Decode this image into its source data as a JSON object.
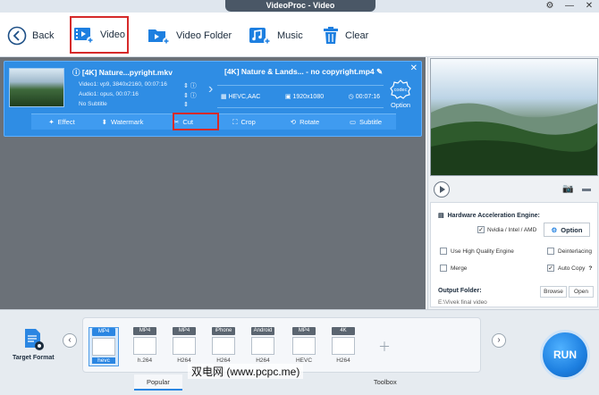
{
  "window": {
    "title": "VideoProc - Video"
  },
  "toolbar": {
    "back_label": "Back",
    "video_label": "Video",
    "video_folder_label": "Video Folder",
    "music_label": "Music",
    "clear_label": "Clear"
  },
  "clip": {
    "source_title": "[4K] Nature...pyright.mkv",
    "video_track": "Video1: vp9, 3840x2160, 00:07:16",
    "audio_track": "Audio1: opus, 00:07:16",
    "subtitle": "No Subtitle",
    "output_title": "[4K] Nature & Lands... - no copyright.mp4",
    "output_codec": "HEVC,AAC",
    "output_resolution": "1920x1080",
    "output_duration": "00:07:16",
    "codec_label": "Option",
    "codec_badge": "codec"
  },
  "edit_bar": {
    "effect": "Effect",
    "watermark": "Watermark",
    "cut": "Cut",
    "crop": "Crop",
    "rotate": "Rotate",
    "subtitle": "Subtitle"
  },
  "settings": {
    "hw_title": "Hardware Acceleration Engine:",
    "nvidia_label": "Nvidia / Intel / AMD",
    "option_label": "Option",
    "high_quality": "Use High Quality Engine",
    "deinterlacing": "Deinterlacing",
    "merge": "Merge",
    "auto_copy": "Auto Copy",
    "auto_copy_help": "?",
    "output_folder_label": "Output Folder:",
    "output_folder_path": "E:\\Vivek final video",
    "browse": "Browse",
    "open": "Open"
  },
  "bottom": {
    "target_format": "Target Format",
    "formats": [
      {
        "tag": "MP4",
        "codec": "hevc",
        "selected": true
      },
      {
        "tag": "MP4",
        "codec": "h.264",
        "selected": false
      },
      {
        "tag": "MP4",
        "codec": "H264",
        "selected": false
      },
      {
        "tag": "iPhone",
        "codec": "H264",
        "selected": false
      },
      {
        "tag": "Android",
        "codec": "H264",
        "selected": false
      },
      {
        "tag": "MP4",
        "codec": "HEVC",
        "selected": false
      },
      {
        "tag": "4K",
        "codec": "H264",
        "selected": false
      }
    ],
    "tabs": [
      "Popular",
      "Toolbox"
    ],
    "run_label": "RUN",
    "watermark_text": "双电网 (www.pcpc.me)"
  },
  "colors": {
    "accent": "#2b86e2",
    "card_bg": "#2f8de4",
    "highlight_red": "#d62a2a"
  }
}
